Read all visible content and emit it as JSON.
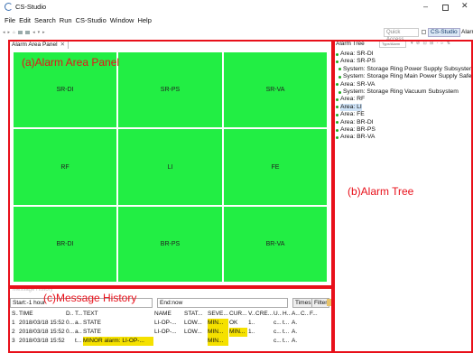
{
  "window": {
    "title": "CS-Studio",
    "min_glyph": "–",
    "close_glyph": "✕"
  },
  "menu": [
    "File",
    "Edit",
    "Search",
    "Run",
    "CS-Studio",
    "Window",
    "Help"
  ],
  "toolbar": {
    "quick_access_placeholder": "Quick Access",
    "perspective_active": "CS-Studio",
    "perspective_other": "Alarm"
  },
  "area_panel": {
    "tab_label": "Alarm Area Panel",
    "cells": [
      {
        "name": "SR-DI",
        "color": "#22ee44"
      },
      {
        "name": "SR-PS",
        "color": "#22ee44"
      },
      {
        "name": "SR-VA",
        "color": "#22ee44"
      },
      {
        "name": "RF",
        "color": "#22ee44"
      },
      {
        "name": "LI",
        "color": "#22ee44"
      },
      {
        "name": "FE",
        "color": "#22ee44"
      },
      {
        "name": "BR-DI",
        "color": "#22ee44"
      },
      {
        "name": "BR-PS",
        "color": "#22ee44"
      },
      {
        "name": "BR-VA",
        "color": "#22ee44"
      }
    ]
  },
  "history": {
    "tab_label": "Message History",
    "start_label": "Start:",
    "start_value": "-1 hour",
    "end_label": "End:",
    "end_value": "now",
    "times_button": "Times",
    "filter_button": "Filter",
    "columns": [
      "S..",
      "TIME",
      "D..",
      "T...",
      "TEXT",
      "NAME",
      "STAT...",
      "SEVE...",
      "CUR...",
      "V...",
      "CRE...",
      "U...",
      "H...",
      "A...",
      "C...",
      "F..."
    ],
    "rows": [
      [
        "1",
        "2018/03/18 15:52:...",
        "0...",
        "a...",
        "STATE",
        "LI-OP-...",
        "LOW...",
        "MIN...",
        "OK",
        "1...",
        "",
        "c...",
        "t...",
        "A.",
        "",
        ""
      ],
      [
        "2",
        "2018/03/18 15:52:...",
        "0...",
        "a...",
        "STATE",
        "LI-OP-...",
        "LOW...",
        "MIN...",
        "MIN...",
        "1...",
        "",
        "c...",
        "t...",
        "A.",
        "",
        ""
      ],
      [
        "3",
        "2018/03/18 15:52:...",
        "",
        "t...",
        "MINOR alarm: LI-OP-...",
        "",
        "",
        "MIN...",
        "",
        "",
        "",
        "c...",
        "t...",
        "A.",
        "",
        ""
      ]
    ],
    "severity_color": "#f5e100"
  },
  "alarm_tree": {
    "tab_label": "Alarm Tree",
    "filter_placeholder": "Type/Alarm",
    "items": [
      {
        "label": "Area: SR-DI",
        "indent": false
      },
      {
        "label": "Area: SR-PS",
        "indent": false
      },
      {
        "label": "System: Storage Ring Power Supply Subsystem",
        "indent": true
      },
      {
        "label": "System: Storage Ring Main Power Supply Safety S",
        "indent": true
      },
      {
        "label": "Area: SR-VA",
        "indent": false
      },
      {
        "label": "System: Storage Ring Vacuum Subsystem",
        "indent": true
      },
      {
        "label": "Area: RF",
        "indent": false
      },
      {
        "label": "Area: LI",
        "indent": false,
        "selected": true
      },
      {
        "label": "Area: FE",
        "indent": false
      },
      {
        "label": "Area: BR-DI",
        "indent": false
      },
      {
        "label": "Area: BR-PS",
        "indent": false
      },
      {
        "label": "Area: BR-VA",
        "indent": false
      }
    ]
  },
  "annotations": {
    "a": "(a)Alarm Area Panel",
    "b": "(b)Alarm Tree",
    "c": "(c)Message History",
    "color": "#e8101a"
  }
}
